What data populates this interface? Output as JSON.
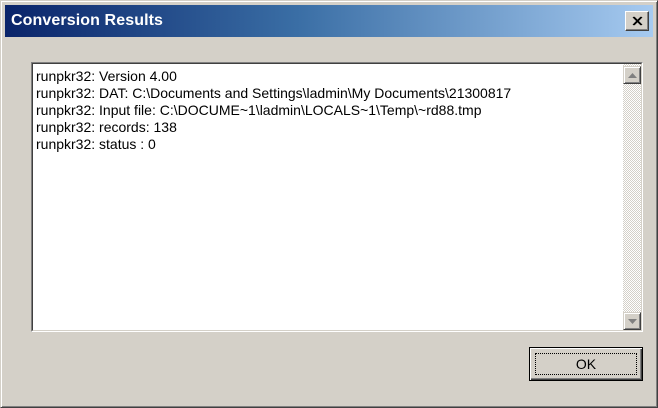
{
  "window": {
    "title": "Conversion Results"
  },
  "output": {
    "lines": [
      "runpkr32:  Version 4.00",
      "runpkr32:  DAT: C:\\Documents and Settings\\ladmin\\My Documents\\21300817",
      "runpkr32:  Input file: C:\\DOCUME~1\\ladmin\\LOCALS~1\\Temp\\~rd88.tmp",
      "runpkr32:  records: 138",
      "runpkr32:  status : 0"
    ]
  },
  "buttons": {
    "ok_label": "OK"
  },
  "icons": {
    "close": "close-icon",
    "scroll_up": "arrow-up-icon",
    "scroll_down": "arrow-down-icon"
  },
  "colors": {
    "titlebar_start": "#0a246a",
    "titlebar_end": "#a6caf0",
    "face": "#d4d0c8"
  }
}
